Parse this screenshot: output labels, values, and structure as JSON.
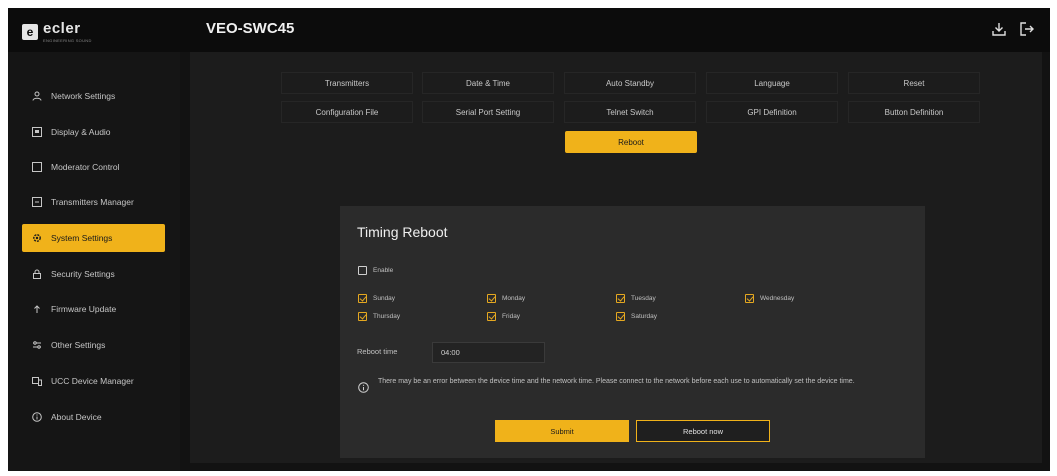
{
  "brand": {
    "name": "ecler",
    "tagline": "ENGINEERING SOUND"
  },
  "header": {
    "device_title": "VEO-SWC45"
  },
  "sidebar": {
    "items": [
      {
        "label": "Network Settings",
        "icon": "person-icon",
        "active": false
      },
      {
        "label": "Display & Audio",
        "icon": "display-icon",
        "active": false
      },
      {
        "label": "Moderator Control",
        "icon": "square-icon",
        "active": false
      },
      {
        "label": "Transmitters Manager",
        "icon": "transmitter-icon",
        "active": false
      },
      {
        "label": "System Settings",
        "icon": "gear-icon",
        "active": true
      },
      {
        "label": "Security Settings",
        "icon": "lock-icon",
        "active": false
      },
      {
        "label": "Firmware Update",
        "icon": "upload-icon",
        "active": false
      },
      {
        "label": "Other Settings",
        "icon": "sliders-icon",
        "active": false
      },
      {
        "label": "UCC Device Manager",
        "icon": "device-icon",
        "active": false
      },
      {
        "label": "About Device",
        "icon": "info-icon",
        "active": false
      }
    ]
  },
  "tabs": {
    "row1": [
      "Transmitters",
      "Date & Time",
      "Auto Standby",
      "Language",
      "Reset"
    ],
    "row2": [
      "Configuration File",
      "Serial Port Setting",
      "Telnet Switch",
      "GPI Definition",
      "Button Definition"
    ],
    "row3": [
      "Reboot"
    ],
    "active": "Reboot"
  },
  "timing_reboot": {
    "title": "Timing Reboot",
    "enable": {
      "label": "Enable",
      "checked": false
    },
    "days": [
      {
        "label": "Sunday",
        "checked": true
      },
      {
        "label": "Monday",
        "checked": true
      },
      {
        "label": "Tuesday",
        "checked": true
      },
      {
        "label": "Wednesday",
        "checked": true
      },
      {
        "label": "Thursday",
        "checked": true
      },
      {
        "label": "Friday",
        "checked": true
      },
      {
        "label": "Saturday",
        "checked": true
      }
    ],
    "reboot_time_label": "Reboot time",
    "reboot_time_value": "04:00",
    "info_text": "There may be an error between the device time and the network time. Please connect to the network before each use to automatically set the device time.",
    "submit_label": "Submit",
    "reboot_now_label": "Reboot now"
  },
  "colors": {
    "accent": "#f0b21a",
    "background": "#121212",
    "panel": "#2b2b2b"
  }
}
